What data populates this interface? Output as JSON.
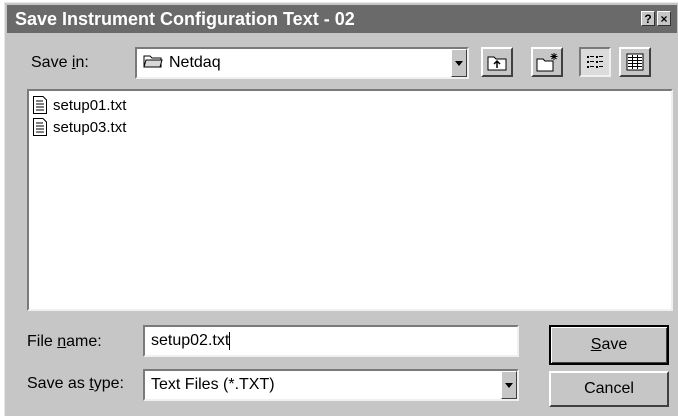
{
  "window": {
    "title": "Save Instrument Configuration Text - 02",
    "help_glyph": "?",
    "close_glyph": "×"
  },
  "save_in": {
    "label_prefix": "Save ",
    "label_mnemonic": "i",
    "label_suffix": "n:",
    "value": "Netdaq",
    "icon": "folder-icon"
  },
  "toolbar": {
    "buttons": [
      {
        "name": "up-one-level-button",
        "icon": "up-folder-icon"
      },
      {
        "name": "create-new-folder-button",
        "icon": "new-folder-icon"
      },
      {
        "name": "list-view-button",
        "icon": "list-view-icon",
        "pressed": true
      },
      {
        "name": "details-view-button",
        "icon": "details-view-icon"
      }
    ]
  },
  "files": [
    {
      "label": "setup01.txt",
      "icon": "text-file-icon"
    },
    {
      "label": "setup03.txt",
      "icon": "text-file-icon"
    }
  ],
  "file_name": {
    "label_prefix": "File ",
    "label_mnemonic": "n",
    "label_suffix": "ame:",
    "value": "setup02.txt"
  },
  "save_as_type": {
    "label_prefix": "Save as ",
    "label_mnemonic": "t",
    "label_suffix": "ype:",
    "value": "Text Files (*.TXT)"
  },
  "buttons": {
    "save_mnemonic": "S",
    "save_rest": "ave",
    "cancel": "Cancel"
  },
  "colors": {
    "titlebar": "#6a6a6a",
    "dialog_bg": "#c6c6c6"
  }
}
